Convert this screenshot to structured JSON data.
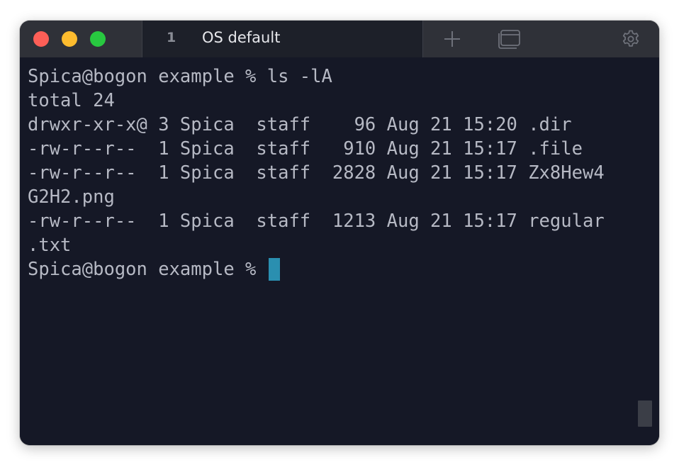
{
  "window": {
    "traffic_lights": [
      {
        "name": "close",
        "color": "#fe5f57"
      },
      {
        "name": "minimize",
        "color": "#febc2e"
      },
      {
        "name": "zoom",
        "color": "#28c840"
      }
    ]
  },
  "tabs": [
    {
      "index": "1",
      "title": "OS default",
      "active": true
    }
  ],
  "toolbar": {
    "new_tab_icon": "plus-icon",
    "windows_icon": "window-stack-icon",
    "settings_icon": "gear-icon"
  },
  "terminal": {
    "lines": [
      "Spica@bogon example % ls -lA",
      "total 24",
      "drwxr-xr-x@ 3 Spica  staff    96 Aug 21 15:20 .dir",
      "-rw-r--r--  1 Spica  staff   910 Aug 21 15:17 .file",
      "-rw-r--r--  1 Spica  staff  2828 Aug 21 15:17 Zx8Hew4",
      "G2H2.png",
      "-rw-r--r--  1 Spica  staff  1213 Aug 21 15:17 regular",
      ".txt"
    ],
    "prompt": "Spica@bogon example % ",
    "cursor_color": "#2a8fb0",
    "text_color": "#b6b9c4",
    "background_color": "#151826"
  }
}
